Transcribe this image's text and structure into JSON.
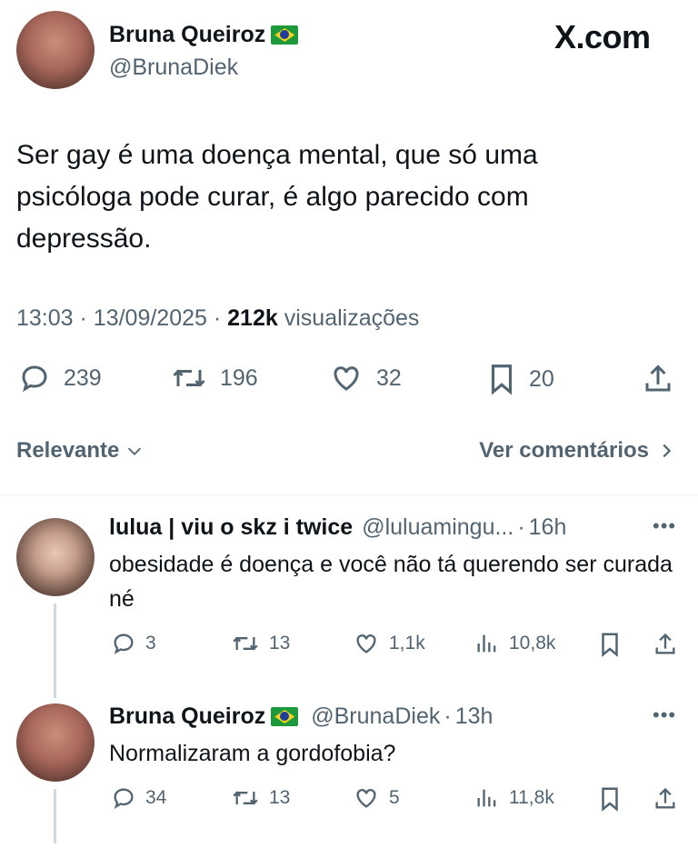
{
  "tweet": {
    "author_name": "Bruna Queiroz",
    "author_handle": "@BrunaDiek",
    "flag_icon": "brazil-flag-icon",
    "site_logo": "X.com",
    "text": "Ser gay é uma doença mental, que só uma psicóloga pode curar, é algo parecido com depressão.",
    "time": "13:03",
    "date": "13/09/2025",
    "views_count": "212k",
    "views_label": "visualizações",
    "replies": "239",
    "retweets": "196",
    "likes": "32",
    "bookmarks": "20"
  },
  "tabs": {
    "sort_label": "Relevante",
    "comments_label": "Ver comentários"
  },
  "replies": [
    {
      "name": "lulua | viu o skz i twice",
      "handle": "@luluamingu...",
      "time": "16h",
      "text": "obesidade é doença e você não tá querendo ser curada né",
      "replies": "3",
      "retweets": "13",
      "likes": "1,1k",
      "views": "10,8k"
    },
    {
      "name": "Bruna Queiroz",
      "handle": "@BrunaDiek",
      "time": "13h",
      "text": "Normalizaram a gordofobia?",
      "replies": "34",
      "retweets": "13",
      "likes": "5",
      "views": "11,8k"
    }
  ],
  "colors": {
    "text": "#0f1419",
    "secondary": "#536471",
    "divider": "#eff3f4",
    "thread_line": "#cfd9de"
  }
}
